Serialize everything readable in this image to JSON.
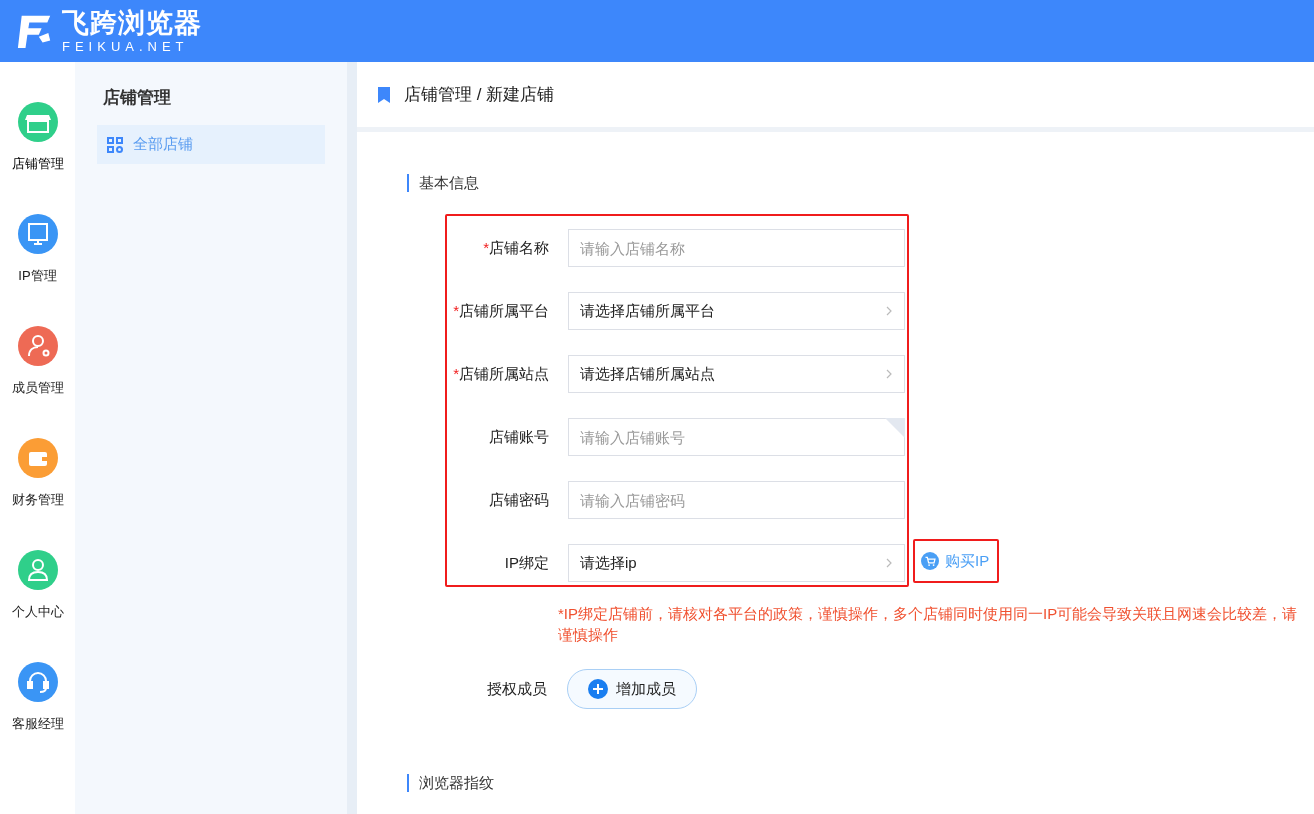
{
  "header": {
    "logo_title": "飞跨浏览器",
    "logo_subtitle": "FEIKUA.NET"
  },
  "rail": [
    {
      "label": "店铺管理",
      "kind": "store",
      "color": "#2fcf8a",
      "selected": true
    },
    {
      "label": "IP管理",
      "kind": "ip",
      "color": "#3a95f5",
      "selected": false
    },
    {
      "label": "成员管理",
      "kind": "members",
      "color": "#ee6a55",
      "selected": false
    },
    {
      "label": "财务管理",
      "kind": "wallet",
      "color": "#fb9d35",
      "selected": false
    },
    {
      "label": "个人中心",
      "kind": "person",
      "color": "#2fcf8a",
      "selected": false
    },
    {
      "label": "客服经理",
      "kind": "support",
      "color": "#3a95f5",
      "selected": false
    }
  ],
  "sidebar": {
    "title": "店铺管理",
    "items": [
      {
        "label": "全部店铺",
        "selected": true
      }
    ]
  },
  "breadcrumb": "店铺管理 / 新建店铺",
  "sections": [
    {
      "title": "基本信息"
    },
    {
      "title": "浏览器指纹"
    }
  ],
  "form": {
    "fields": [
      {
        "label": "店铺名称",
        "required": true,
        "kind": "input",
        "placeholder": "请输入店铺名称",
        "tip": false
      },
      {
        "label": "店铺所属平台",
        "required": true,
        "kind": "select",
        "value": "请选择店铺所属平台",
        "tip": false
      },
      {
        "label": "店铺所属站点",
        "required": true,
        "kind": "select",
        "value": "请选择店铺所属站点",
        "tip": false
      },
      {
        "label": "店铺账号",
        "required": false,
        "kind": "input",
        "placeholder": "请输入店铺账号",
        "tip": true
      },
      {
        "label": "店铺密码",
        "required": false,
        "kind": "input",
        "placeholder": "请输入店铺密码",
        "tip": false
      },
      {
        "label": "IP绑定",
        "required": false,
        "kind": "select",
        "value": "请选择ip",
        "tip": false
      }
    ],
    "required_mark": "*",
    "buy_ip": "购买IP",
    "warning": "*IP绑定店铺前，请核对各平台的政策，谨慎操作，多个店铺同时使用同一IP可能会导致关联且网速会比较差，请谨慎操作",
    "members_label": "授权成员",
    "add_member": "增加成员"
  }
}
